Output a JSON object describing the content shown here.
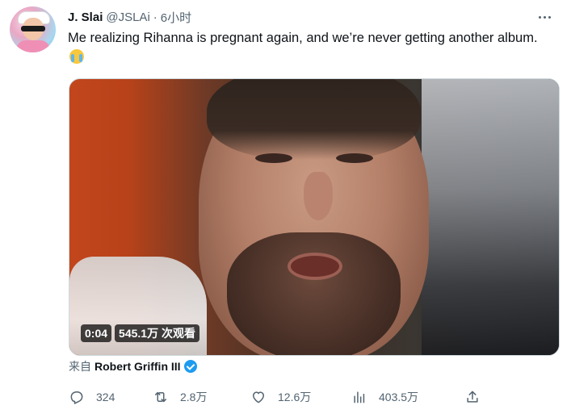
{
  "tweet": {
    "author_name": "J. Slai",
    "author_handle": "@JSLAi",
    "separator": "·",
    "time": "6小时",
    "text": "Me realizing Rihanna is pregnant again, and we’re never getting another album.",
    "emoji": "loudly-crying-face"
  },
  "media": {
    "duration": "0:04",
    "views": "545.1万 次观看"
  },
  "source": {
    "prefix": "来自",
    "name": "Robert Griffin III",
    "verified": true
  },
  "actions": {
    "replies": "324",
    "retweets": "2.8万",
    "likes": "12.6万",
    "views": "403.5万"
  },
  "colors": {
    "text": "#0f1419",
    "muted": "#536471",
    "verified": "#1d9bf0",
    "border": "#cfd9de"
  }
}
